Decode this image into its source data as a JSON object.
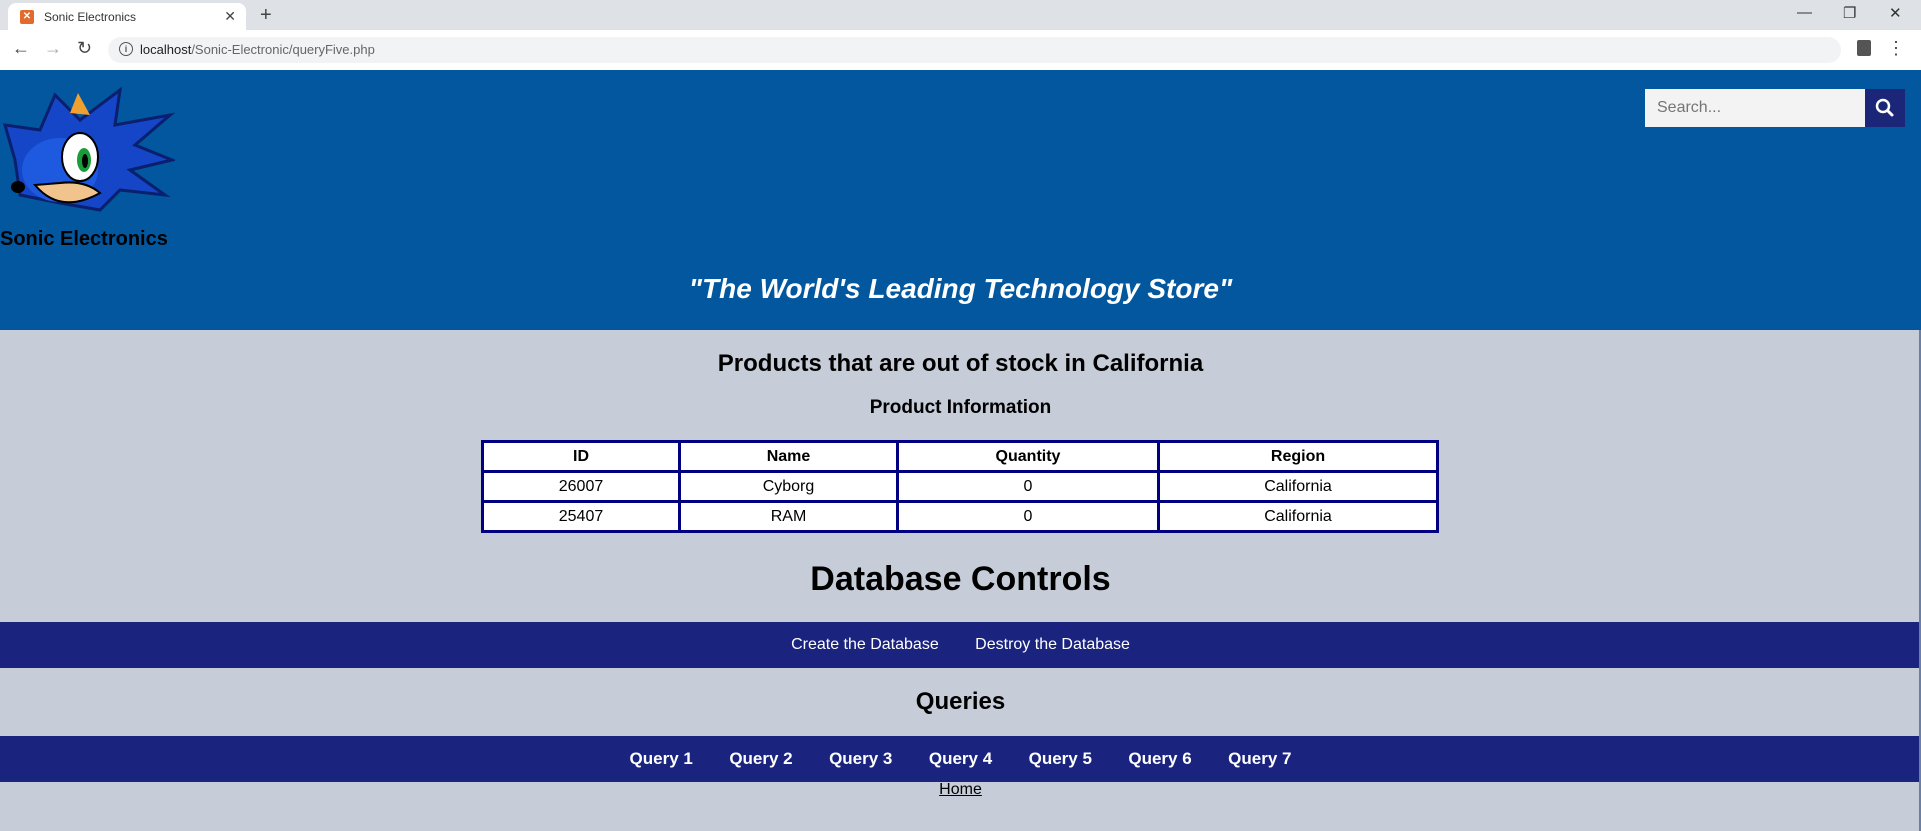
{
  "browser": {
    "tab_title": "Sonic Electronics",
    "url_host": "localhost",
    "url_path": "/Sonic-Electronic/queryFive.php"
  },
  "header": {
    "brand": "Sonic Electronics",
    "search_placeholder": "Search...",
    "tagline": "\"The World's Leading Technology Store\""
  },
  "main": {
    "title": "Products that are out of stock in California",
    "subtitle": "Product Information",
    "table": {
      "headers": [
        "ID",
        "Name",
        "Quantity",
        "Region"
      ],
      "rows": [
        [
          "26007",
          "Cyborg",
          "0",
          "California"
        ],
        [
          "25407",
          "RAM",
          "0",
          "California"
        ]
      ]
    },
    "db_controls_title": "Database Controls",
    "db_controls": [
      "Create the Database",
      "Destroy the Database"
    ],
    "queries_title": "Queries",
    "queries": [
      "Query 1",
      "Query 2",
      "Query 3",
      "Query 4",
      "Query 5",
      "Query 6",
      "Query 7"
    ],
    "home_link": "Home"
  },
  "colors": {
    "header_bg": "#02579e",
    "nav_bar_bg": "#1a237e",
    "table_border": "#000080",
    "page_bg": "#c6cdd8"
  }
}
